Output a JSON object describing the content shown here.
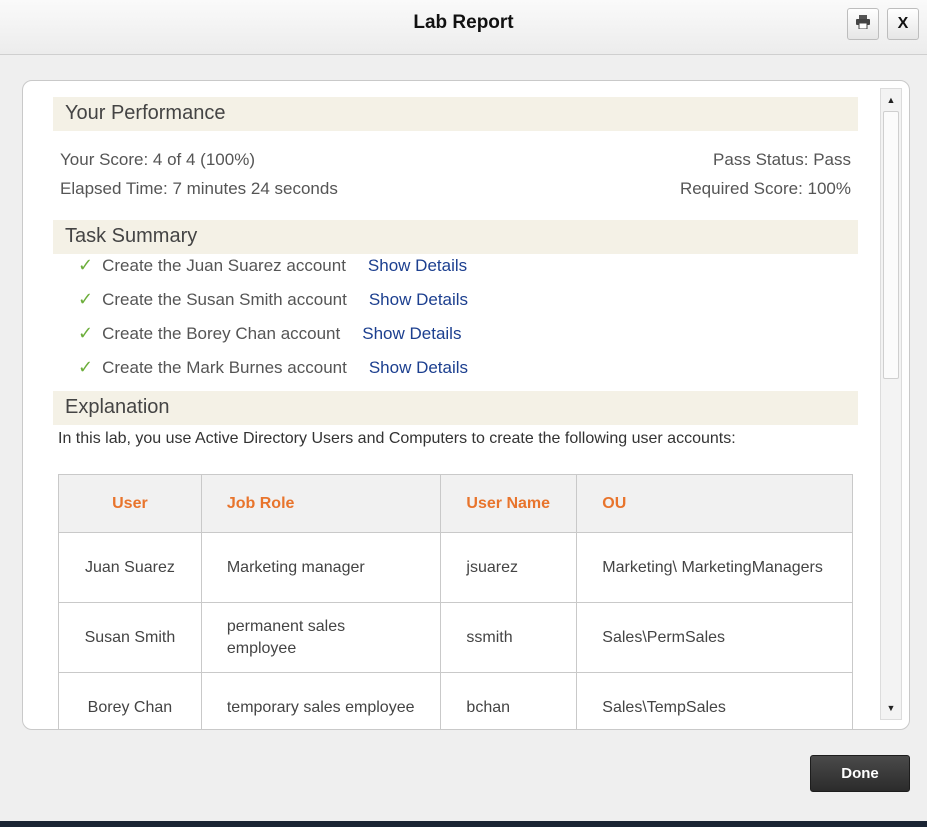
{
  "window": {
    "title": "Lab Report",
    "close_label": "X"
  },
  "performance": {
    "heading": "Your Performance",
    "score": "Your Score: 4 of 4 (100%)",
    "elapsed": "Elapsed Time: 7 minutes 24 seconds",
    "pass_status": "Pass Status: Pass",
    "required_score": "Required Score: 100%"
  },
  "task_summary": {
    "heading": "Task Summary",
    "tasks": [
      {
        "label": "Create the Juan Suarez account",
        "link": "Show Details",
        "status": "pass"
      },
      {
        "label": "Create the Susan Smith account",
        "link": "Show Details",
        "status": "pass"
      },
      {
        "label": "Create the Borey Chan account",
        "link": "Show Details",
        "status": "pass"
      },
      {
        "label": "Create the Mark Burnes account",
        "link": "Show Details",
        "status": "pass"
      }
    ]
  },
  "explanation": {
    "heading": "Explanation",
    "text": "In this lab, you use Active Directory Users and Computers to create the following user accounts:",
    "table": {
      "headers": [
        "User",
        "Job Role",
        "User Name",
        "OU"
      ],
      "rows": [
        [
          "Juan Suarez",
          "Marketing manager",
          "jsuarez",
          "Marketing\\ MarketingManagers"
        ],
        [
          "Susan Smith",
          "permanent sales employee",
          "ssmith",
          "Sales\\PermSales"
        ],
        [
          "Borey Chan",
          "temporary sales employee",
          "bchan",
          "Sales\\TempSales"
        ]
      ]
    }
  },
  "footer": {
    "done_label": "Done"
  },
  "colors": {
    "check": "#6cae3b",
    "link": "#1c3f8f",
    "table_header": "#e8742c",
    "section_bg": "#f4f1e6"
  },
  "icons": {
    "print": "printer-icon",
    "check": "checkmark-icon"
  }
}
